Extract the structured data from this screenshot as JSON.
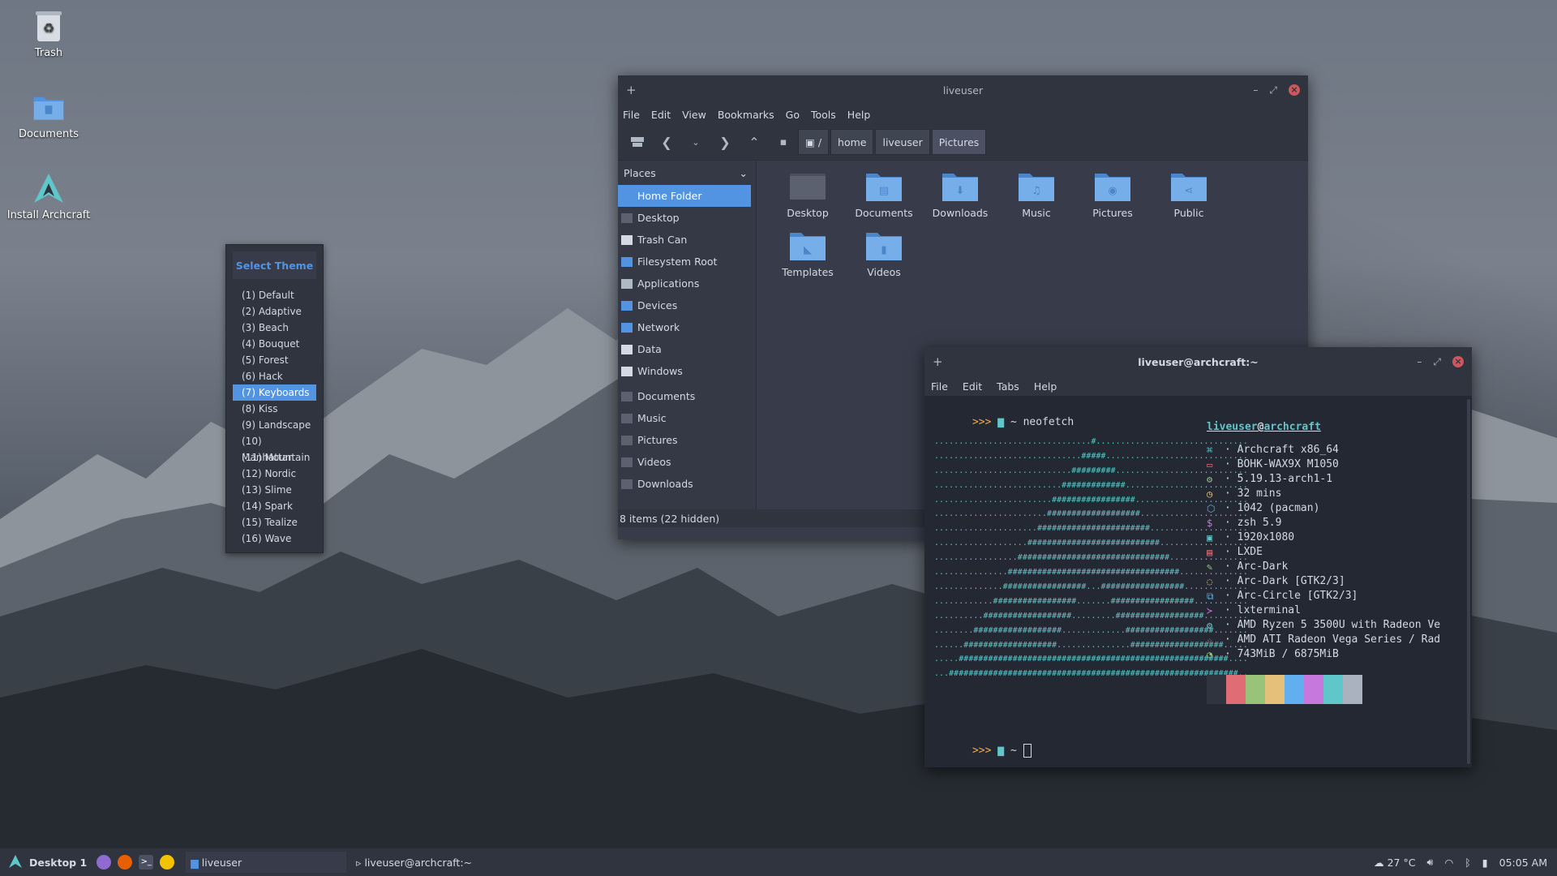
{
  "desktop": {
    "icons": [
      {
        "label": "Trash",
        "icon": "trash-icon"
      },
      {
        "label": "Documents",
        "icon": "folder-icon"
      },
      {
        "label": "Install Archcraft",
        "icon": "archcraft-logo-icon"
      }
    ]
  },
  "theme_menu": {
    "title": "Select Theme",
    "selected_index": 6,
    "items": [
      "(1) Default",
      "(2) Adaptive",
      "(3) Beach",
      "(4) Bouquet",
      "(5) Forest",
      "(6) Hack",
      "(7) Keyboards",
      "(8) Kiss",
      "(9) Landscape",
      "(10) Manhattan",
      "(11) Mountain",
      "(12) Nordic",
      "(13) Slime",
      "(14) Spark",
      "(15) Tealize",
      "(16) Wave"
    ]
  },
  "file_manager": {
    "title": "liveuser",
    "menu": [
      "File",
      "Edit",
      "View",
      "Bookmarks",
      "Go",
      "Tools",
      "Help"
    ],
    "breadcrumb": [
      "/",
      "home",
      "liveuser",
      "Pictures"
    ],
    "places_label": "Places",
    "places": [
      "Home Folder",
      "Desktop",
      "Trash Can",
      "Filesystem Root",
      "Applications",
      "Devices",
      "Network",
      "Data",
      "Windows"
    ],
    "bookmarks": [
      "Documents",
      "Music",
      "Pictures",
      "Videos",
      "Downloads"
    ],
    "folders": [
      {
        "label": "Desktop",
        "icon": "desktop-folder-icon"
      },
      {
        "label": "Documents",
        "icon": "documents-folder-icon"
      },
      {
        "label": "Downloads",
        "icon": "downloads-folder-icon"
      },
      {
        "label": "Music",
        "icon": "music-folder-icon"
      },
      {
        "label": "Pictures",
        "icon": "pictures-folder-icon"
      },
      {
        "label": "Public",
        "icon": "public-folder-icon"
      },
      {
        "label": "Templates",
        "icon": "templates-folder-icon"
      },
      {
        "label": "Videos",
        "icon": "videos-folder-icon"
      }
    ],
    "status": "8 items (22 hidden)"
  },
  "terminal": {
    "title": "liveuser@archcraft:~",
    "menu": [
      "File",
      "Edit",
      "Tabs",
      "Help"
    ],
    "prompt_symbol": ">>>",
    "command": "~ neofetch",
    "prompt2": "~",
    "user": "liveuser",
    "at": "@",
    "host": "archcraft",
    "info": [
      {
        "icon": "⌘",
        "color": "#5fc6c9",
        "text": "Archcraft x86_64"
      },
      {
        "icon": "▭",
        "color": "#e06c75",
        "text": "BOHK-WAX9X M1050"
      },
      {
        "icon": "⚙",
        "color": "#98c379",
        "text": "5.19.13-arch1-1"
      },
      {
        "icon": "◷",
        "color": "#e5c07b",
        "text": "32 mins"
      },
      {
        "icon": "⬡",
        "color": "#61afef",
        "text": "1042 (pacman)"
      },
      {
        "icon": "$",
        "color": "#c678dd",
        "text": "zsh 5.9"
      },
      {
        "icon": "▣",
        "color": "#5fc6c9",
        "text": "1920x1080"
      },
      {
        "icon": "▤",
        "color": "#e06c75",
        "text": "LXDE"
      },
      {
        "icon": "✎",
        "color": "#98c379",
        "text": "Arc-Dark"
      },
      {
        "icon": "◌",
        "color": "#e5c07b",
        "text": "Arc-Dark [GTK2/3]"
      },
      {
        "icon": "⧉",
        "color": "#61afef",
        "text": "Arc-Circle [GTK2/3]"
      },
      {
        "icon": "≻",
        "color": "#c678dd",
        "text": "lxterminal"
      },
      {
        "icon": "⚙",
        "color": "#5fc6c9",
        "text": "AMD Ryzen 5 3500U with Radeon Ve"
      },
      {
        "icon": "☆",
        "color": "#e06c75",
        "text": "AMD ATI Radeon Vega Series / Rad"
      },
      {
        "icon": "◔",
        "color": "#98c379",
        "text": "743MiB / 6875MiB"
      }
    ],
    "palette": [
      "#2f343f",
      "#e06c75",
      "#98c379",
      "#e5c07b",
      "#61afef",
      "#c678dd",
      "#5fc6c9",
      "#abb2bf"
    ]
  },
  "taskbar": {
    "desktop_label": "Desktop 1",
    "tasks": [
      "liveuser",
      "liveuser@archcraft:~"
    ],
    "temperature": "27 °C",
    "clock": "05:05 AM"
  }
}
